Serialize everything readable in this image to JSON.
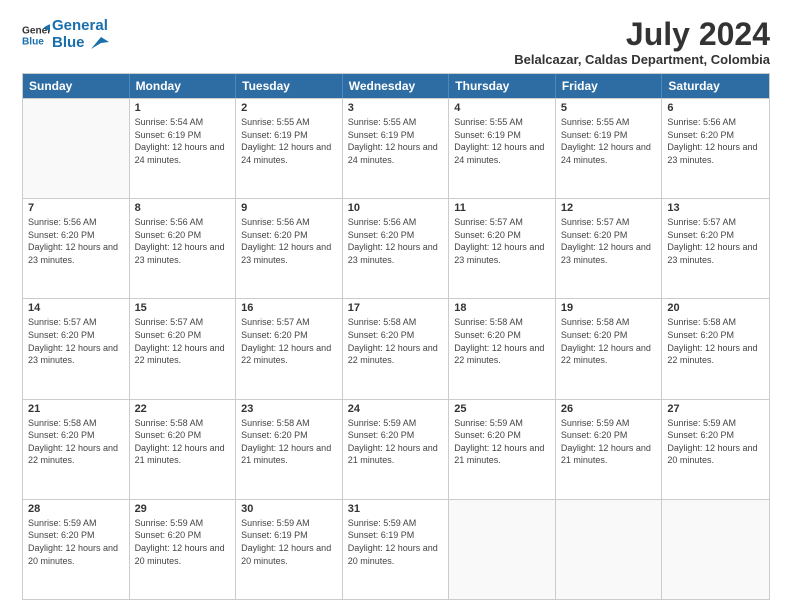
{
  "header": {
    "logo_line1": "General",
    "logo_line2": "Blue",
    "month_year": "July 2024",
    "location": "Belalcazar, Caldas Department, Colombia"
  },
  "days_of_week": [
    "Sunday",
    "Monday",
    "Tuesday",
    "Wednesday",
    "Thursday",
    "Friday",
    "Saturday"
  ],
  "weeks": [
    [
      {
        "day": "",
        "empty": true
      },
      {
        "day": "1",
        "sunrise": "5:54 AM",
        "sunset": "6:19 PM",
        "daylight": "12 hours and 24 minutes."
      },
      {
        "day": "2",
        "sunrise": "5:55 AM",
        "sunset": "6:19 PM",
        "daylight": "12 hours and 24 minutes."
      },
      {
        "day": "3",
        "sunrise": "5:55 AM",
        "sunset": "6:19 PM",
        "daylight": "12 hours and 24 minutes."
      },
      {
        "day": "4",
        "sunrise": "5:55 AM",
        "sunset": "6:19 PM",
        "daylight": "12 hours and 24 minutes."
      },
      {
        "day": "5",
        "sunrise": "5:55 AM",
        "sunset": "6:19 PM",
        "daylight": "12 hours and 24 minutes."
      },
      {
        "day": "6",
        "sunrise": "5:56 AM",
        "sunset": "6:20 PM",
        "daylight": "12 hours and 23 minutes."
      }
    ],
    [
      {
        "day": "7",
        "sunrise": "5:56 AM",
        "sunset": "6:20 PM",
        "daylight": "12 hours and 23 minutes."
      },
      {
        "day": "8",
        "sunrise": "5:56 AM",
        "sunset": "6:20 PM",
        "daylight": "12 hours and 23 minutes."
      },
      {
        "day": "9",
        "sunrise": "5:56 AM",
        "sunset": "6:20 PM",
        "daylight": "12 hours and 23 minutes."
      },
      {
        "day": "10",
        "sunrise": "5:56 AM",
        "sunset": "6:20 PM",
        "daylight": "12 hours and 23 minutes."
      },
      {
        "day": "11",
        "sunrise": "5:57 AM",
        "sunset": "6:20 PM",
        "daylight": "12 hours and 23 minutes."
      },
      {
        "day": "12",
        "sunrise": "5:57 AM",
        "sunset": "6:20 PM",
        "daylight": "12 hours and 23 minutes."
      },
      {
        "day": "13",
        "sunrise": "5:57 AM",
        "sunset": "6:20 PM",
        "daylight": "12 hours and 23 minutes."
      }
    ],
    [
      {
        "day": "14",
        "sunrise": "5:57 AM",
        "sunset": "6:20 PM",
        "daylight": "12 hours and 23 minutes."
      },
      {
        "day": "15",
        "sunrise": "5:57 AM",
        "sunset": "6:20 PM",
        "daylight": "12 hours and 22 minutes."
      },
      {
        "day": "16",
        "sunrise": "5:57 AM",
        "sunset": "6:20 PM",
        "daylight": "12 hours and 22 minutes."
      },
      {
        "day": "17",
        "sunrise": "5:58 AM",
        "sunset": "6:20 PM",
        "daylight": "12 hours and 22 minutes."
      },
      {
        "day": "18",
        "sunrise": "5:58 AM",
        "sunset": "6:20 PM",
        "daylight": "12 hours and 22 minutes."
      },
      {
        "day": "19",
        "sunrise": "5:58 AM",
        "sunset": "6:20 PM",
        "daylight": "12 hours and 22 minutes."
      },
      {
        "day": "20",
        "sunrise": "5:58 AM",
        "sunset": "6:20 PM",
        "daylight": "12 hours and 22 minutes."
      }
    ],
    [
      {
        "day": "21",
        "sunrise": "5:58 AM",
        "sunset": "6:20 PM",
        "daylight": "12 hours and 22 minutes."
      },
      {
        "day": "22",
        "sunrise": "5:58 AM",
        "sunset": "6:20 PM",
        "daylight": "12 hours and 21 minutes."
      },
      {
        "day": "23",
        "sunrise": "5:58 AM",
        "sunset": "6:20 PM",
        "daylight": "12 hours and 21 minutes."
      },
      {
        "day": "24",
        "sunrise": "5:59 AM",
        "sunset": "6:20 PM",
        "daylight": "12 hours and 21 minutes."
      },
      {
        "day": "25",
        "sunrise": "5:59 AM",
        "sunset": "6:20 PM",
        "daylight": "12 hours and 21 minutes."
      },
      {
        "day": "26",
        "sunrise": "5:59 AM",
        "sunset": "6:20 PM",
        "daylight": "12 hours and 21 minutes."
      },
      {
        "day": "27",
        "sunrise": "5:59 AM",
        "sunset": "6:20 PM",
        "daylight": "12 hours and 20 minutes."
      }
    ],
    [
      {
        "day": "28",
        "sunrise": "5:59 AM",
        "sunset": "6:20 PM",
        "daylight": "12 hours and 20 minutes."
      },
      {
        "day": "29",
        "sunrise": "5:59 AM",
        "sunset": "6:20 PM",
        "daylight": "12 hours and 20 minutes."
      },
      {
        "day": "30",
        "sunrise": "5:59 AM",
        "sunset": "6:19 PM",
        "daylight": "12 hours and 20 minutes."
      },
      {
        "day": "31",
        "sunrise": "5:59 AM",
        "sunset": "6:19 PM",
        "daylight": "12 hours and 20 minutes."
      },
      {
        "day": "",
        "empty": true
      },
      {
        "day": "",
        "empty": true
      },
      {
        "day": "",
        "empty": true
      }
    ]
  ]
}
